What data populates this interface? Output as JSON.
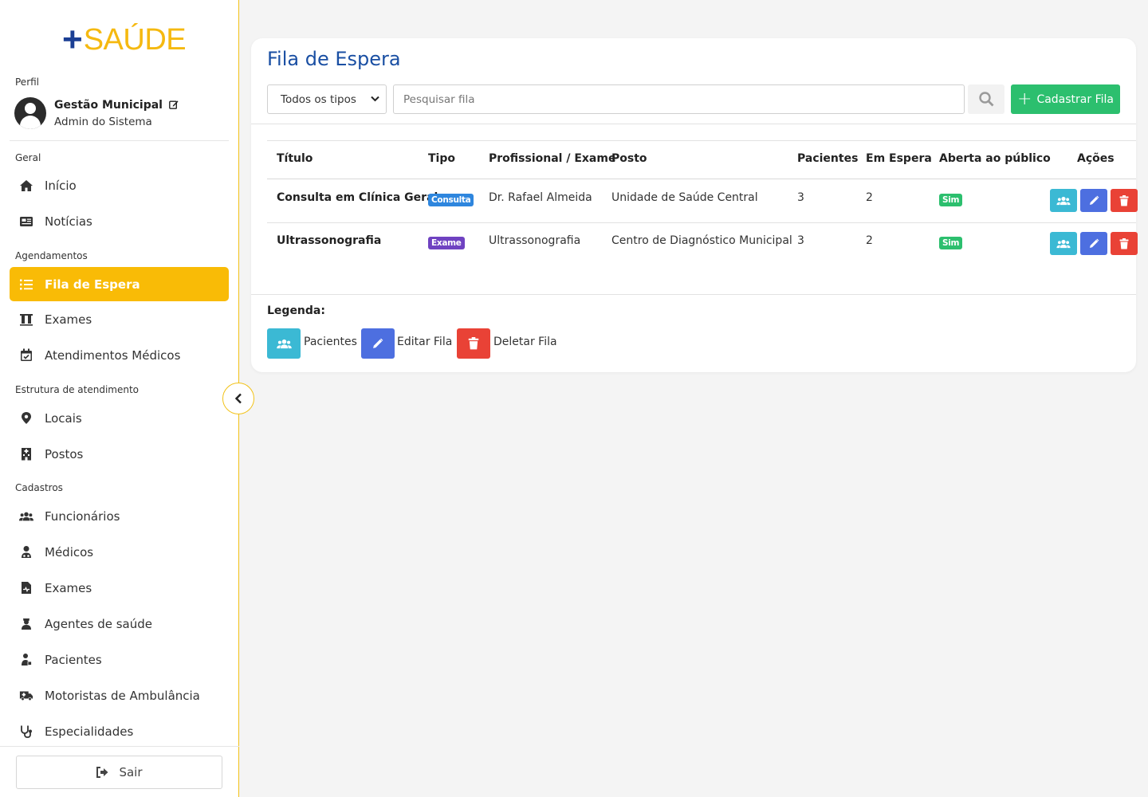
{
  "brand": {
    "plus": "+",
    "word": "SAÚDE"
  },
  "sidebar": {
    "profile_label": "Perfil",
    "profile": {
      "name": "Gestão Municipal",
      "role": "Admin do Sistema"
    },
    "sections": {
      "geral": "Geral",
      "agendamentos": "Agendamentos",
      "estrutura": "Estrutura de atendimento",
      "cadastros": "Cadastros"
    },
    "items": [
      {
        "label": "Início",
        "icon": "home-icon"
      },
      {
        "label": "Notícias",
        "icon": "newspaper-icon"
      },
      {
        "label": "Fila de Espera",
        "icon": "list-icon",
        "active": true
      },
      {
        "label": "Exames",
        "icon": "vials-icon"
      },
      {
        "label": "Atendimentos Médicos",
        "icon": "calendar-check-icon"
      },
      {
        "label": "Locais",
        "icon": "map-pin-icon"
      },
      {
        "label": "Postos",
        "icon": "hospital-icon"
      },
      {
        "label": "Funcionários",
        "icon": "users-icon"
      },
      {
        "label": "Médicos",
        "icon": "doctor-icon"
      },
      {
        "label": "Exames",
        "icon": "file-medical-icon"
      },
      {
        "label": "Agentes de saúde",
        "icon": "nurse-icon"
      },
      {
        "label": "Pacientes",
        "icon": "patient-icon"
      },
      {
        "label": "Motoristas de Ambulância",
        "icon": "ambulance-icon"
      },
      {
        "label": "Especialidades",
        "icon": "stethoscope-icon"
      }
    ],
    "logout_label": "Sair"
  },
  "main": {
    "title": "Fila de Espera",
    "filter": {
      "selected": "Todos os tipos"
    },
    "search": {
      "placeholder": "Pesquisar fila",
      "value": ""
    },
    "add_button": "Cadastrar Fila",
    "table": {
      "headers": [
        "Título",
        "Tipo",
        "Profissional / Exame",
        "Posto",
        "Pacientes",
        "Em Espera",
        "Aberta ao público",
        "Ações"
      ],
      "rows": [
        {
          "titulo": "Consulta em Clínica Geral",
          "tipo": "Consulta",
          "profissional": "Dr. Rafael Almeida",
          "posto": "Unidade de Saúde Central",
          "pacientes": "3",
          "espera": "2",
          "aberta": "Sim"
        },
        {
          "titulo": "Ultrassonografia",
          "tipo": "Exame",
          "profissional": "Ultrassonografia",
          "posto": "Centro de Diagnóstico Municipal",
          "pacientes": "3",
          "espera": "2",
          "aberta": "Sim"
        }
      ]
    },
    "legend": {
      "title": "Legenda:",
      "items": [
        "Pacientes",
        "Editar Fila",
        "Deletar Fila"
      ]
    }
  },
  "colors": {
    "accent_yellow": "#f9bb06",
    "brand_blue": "#1b3f94",
    "title_blue": "#1a4fa3",
    "success_green": "#2cbf6e",
    "teal": "#3bb9d4",
    "indigo": "#4d6fe0",
    "danger_red": "#e94236"
  }
}
